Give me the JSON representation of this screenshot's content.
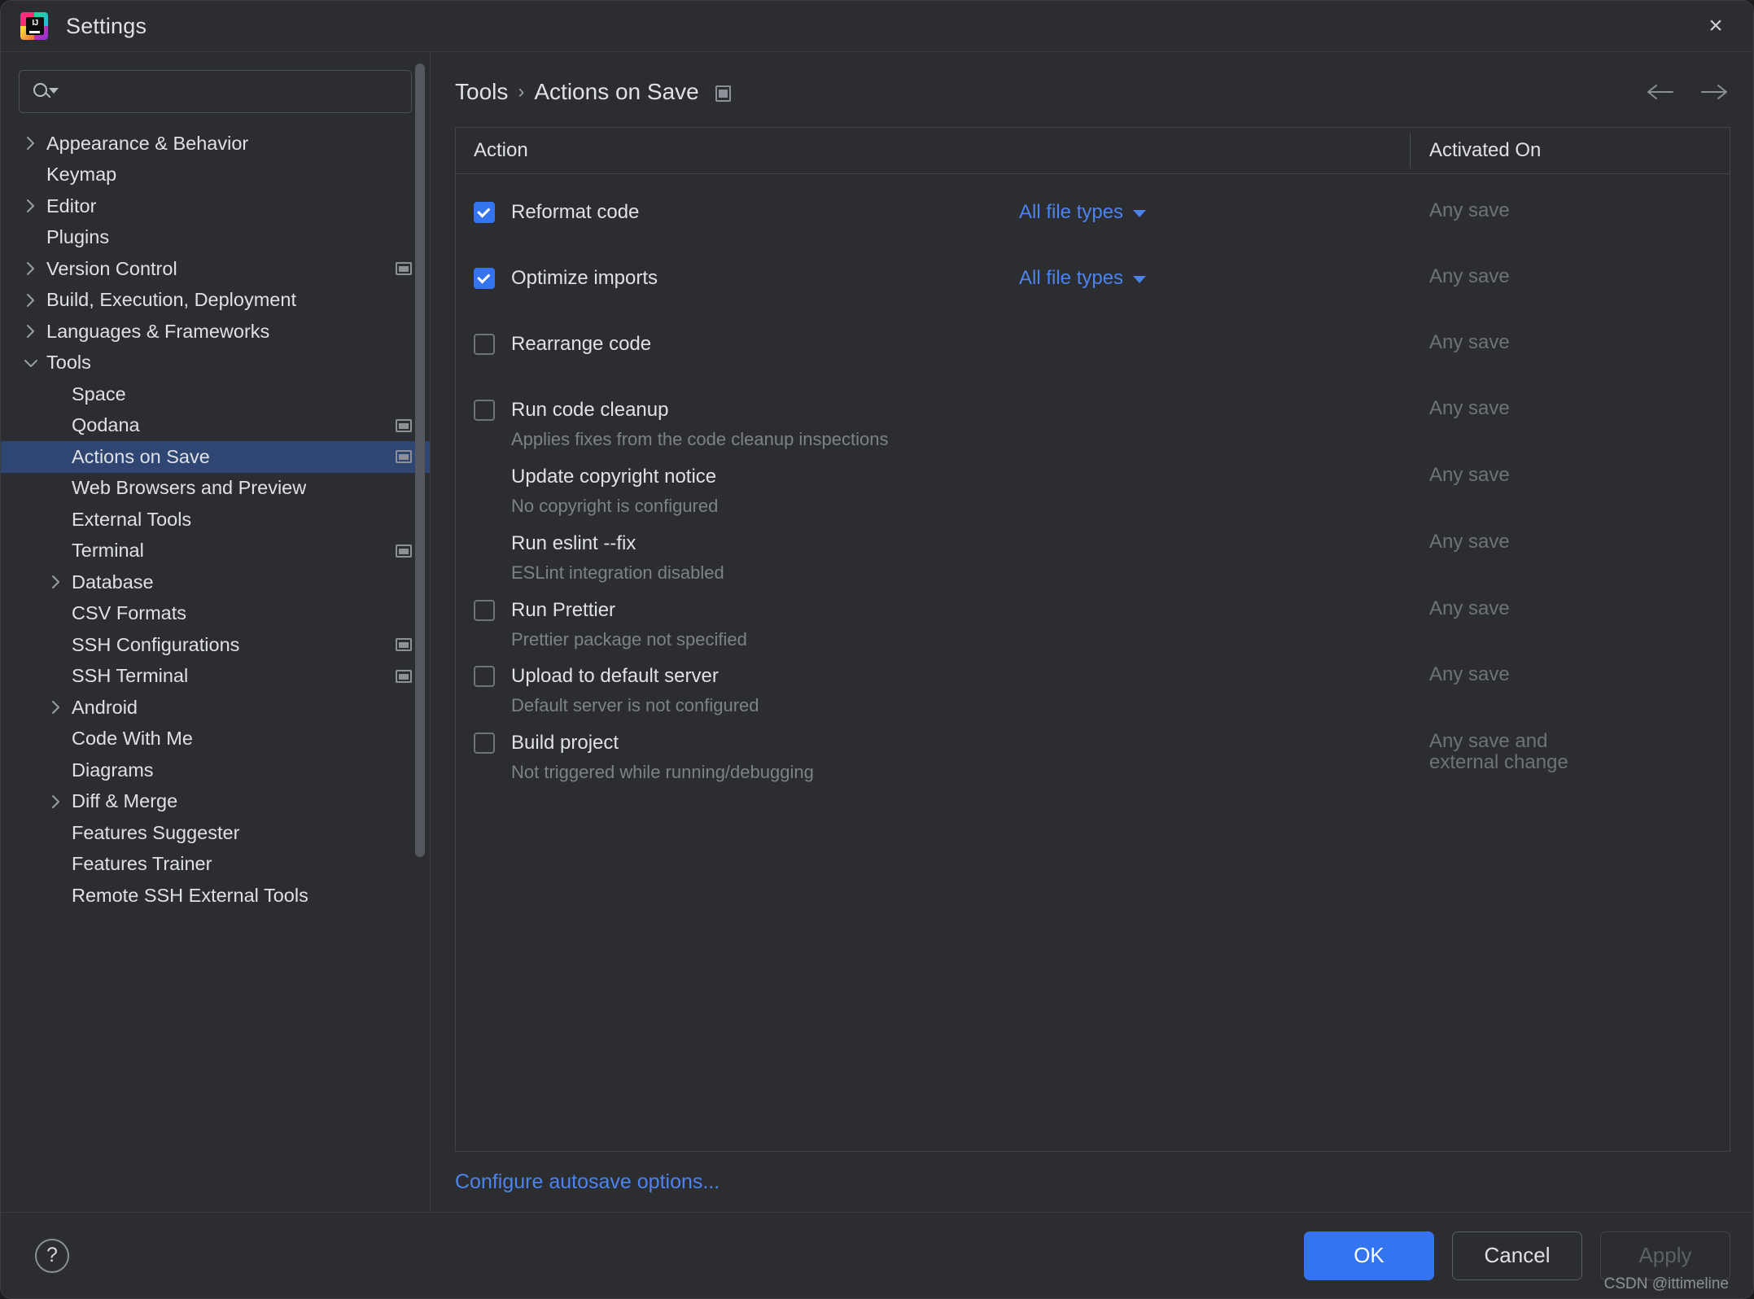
{
  "window": {
    "title": "Settings",
    "logo_text": "IJ",
    "close_icon": "×"
  },
  "search": {
    "value": "",
    "placeholder": ""
  },
  "sidebar": {
    "items": [
      {
        "label": "Appearance & Behavior",
        "indent": 0,
        "arrow": "right",
        "project_icon": false,
        "selected": false
      },
      {
        "label": "Keymap",
        "indent": 0,
        "arrow": "none",
        "project_icon": false,
        "selected": false
      },
      {
        "label": "Editor",
        "indent": 0,
        "arrow": "right",
        "project_icon": false,
        "selected": false
      },
      {
        "label": "Plugins",
        "indent": 0,
        "arrow": "none",
        "project_icon": false,
        "selected": false
      },
      {
        "label": "Version Control",
        "indent": 0,
        "arrow": "right",
        "project_icon": true,
        "selected": false
      },
      {
        "label": "Build, Execution, Deployment",
        "indent": 0,
        "arrow": "right",
        "project_icon": false,
        "selected": false
      },
      {
        "label": "Languages & Frameworks",
        "indent": 0,
        "arrow": "right",
        "project_icon": false,
        "selected": false
      },
      {
        "label": "Tools",
        "indent": 0,
        "arrow": "down",
        "project_icon": false,
        "selected": false
      },
      {
        "label": "Space",
        "indent": 1,
        "arrow": "none",
        "project_icon": false,
        "selected": false
      },
      {
        "label": "Qodana",
        "indent": 1,
        "arrow": "none",
        "project_icon": true,
        "selected": false
      },
      {
        "label": "Actions on Save",
        "indent": 1,
        "arrow": "none",
        "project_icon": true,
        "selected": true
      },
      {
        "label": "Web Browsers and Preview",
        "indent": 1,
        "arrow": "none",
        "project_icon": false,
        "selected": false
      },
      {
        "label": "External Tools",
        "indent": 1,
        "arrow": "none",
        "project_icon": false,
        "selected": false
      },
      {
        "label": "Terminal",
        "indent": 1,
        "arrow": "none",
        "project_icon": true,
        "selected": false
      },
      {
        "label": "Database",
        "indent": 1,
        "arrow": "right",
        "project_icon": false,
        "selected": false
      },
      {
        "label": "CSV Formats",
        "indent": 1,
        "arrow": "none",
        "project_icon": false,
        "selected": false
      },
      {
        "label": "SSH Configurations",
        "indent": 1,
        "arrow": "none",
        "project_icon": true,
        "selected": false
      },
      {
        "label": "SSH Terminal",
        "indent": 1,
        "arrow": "none",
        "project_icon": true,
        "selected": false
      },
      {
        "label": "Android",
        "indent": 1,
        "arrow": "right",
        "project_icon": false,
        "selected": false
      },
      {
        "label": "Code With Me",
        "indent": 1,
        "arrow": "none",
        "project_icon": false,
        "selected": false
      },
      {
        "label": "Diagrams",
        "indent": 1,
        "arrow": "none",
        "project_icon": false,
        "selected": false
      },
      {
        "label": "Diff & Merge",
        "indent": 1,
        "arrow": "right",
        "project_icon": false,
        "selected": false
      },
      {
        "label": "Features Suggester",
        "indent": 1,
        "arrow": "none",
        "project_icon": false,
        "selected": false
      },
      {
        "label": "Features Trainer",
        "indent": 1,
        "arrow": "none",
        "project_icon": false,
        "selected": false
      },
      {
        "label": "Remote SSH External Tools",
        "indent": 1,
        "arrow": "none",
        "project_icon": false,
        "selected": false
      }
    ]
  },
  "breadcrumb": {
    "parent": "Tools",
    "separator": "›",
    "current": "Actions on Save"
  },
  "nav": {
    "back_icon": "←",
    "forward_icon": "→"
  },
  "table": {
    "columns": [
      "Action",
      "Activated On"
    ],
    "rows": [
      {
        "label": "Reformat code",
        "desc": "",
        "checkbox": "checked",
        "scope": "All file types",
        "activated": "Any save"
      },
      {
        "label": "Optimize imports",
        "desc": "",
        "checkbox": "checked",
        "scope": "All file types",
        "activated": "Any save"
      },
      {
        "label": "Rearrange code",
        "desc": "",
        "checkbox": "unchecked",
        "scope": "",
        "activated": "Any save"
      },
      {
        "label": "Run code cleanup",
        "desc": "Applies fixes from the code cleanup inspections",
        "checkbox": "unchecked",
        "scope": "",
        "activated": "Any save"
      },
      {
        "label": "Update copyright notice",
        "desc": "No copyright is configured",
        "checkbox": "none",
        "scope": "",
        "activated": "Any save"
      },
      {
        "label": "Run eslint --fix",
        "desc": "ESLint integration disabled",
        "checkbox": "none",
        "scope": "",
        "activated": "Any save"
      },
      {
        "label": "Run Prettier",
        "desc": "Prettier package not specified",
        "checkbox": "unchecked",
        "scope": "",
        "activated": "Any save"
      },
      {
        "label": "Upload to default server",
        "desc": "Default server is not configured",
        "checkbox": "unchecked",
        "scope": "",
        "activated": "Any save"
      },
      {
        "label": "Build project",
        "desc": "Not triggered while running/debugging",
        "checkbox": "unchecked",
        "scope": "",
        "activated": "Any save and\nexternal change"
      }
    ]
  },
  "autosave": {
    "link": "Configure autosave options..."
  },
  "footer": {
    "help_label": "?",
    "ok": "OK",
    "cancel": "Cancel",
    "apply": "Apply",
    "watermark": "CSDN @ittimeline"
  },
  "colors": {
    "accent": "#3574f0",
    "link": "#4d83f0",
    "selection": "#2f4673",
    "background": "#2b2d30",
    "text": "#dfe1e5",
    "muted": "#6f7278"
  }
}
